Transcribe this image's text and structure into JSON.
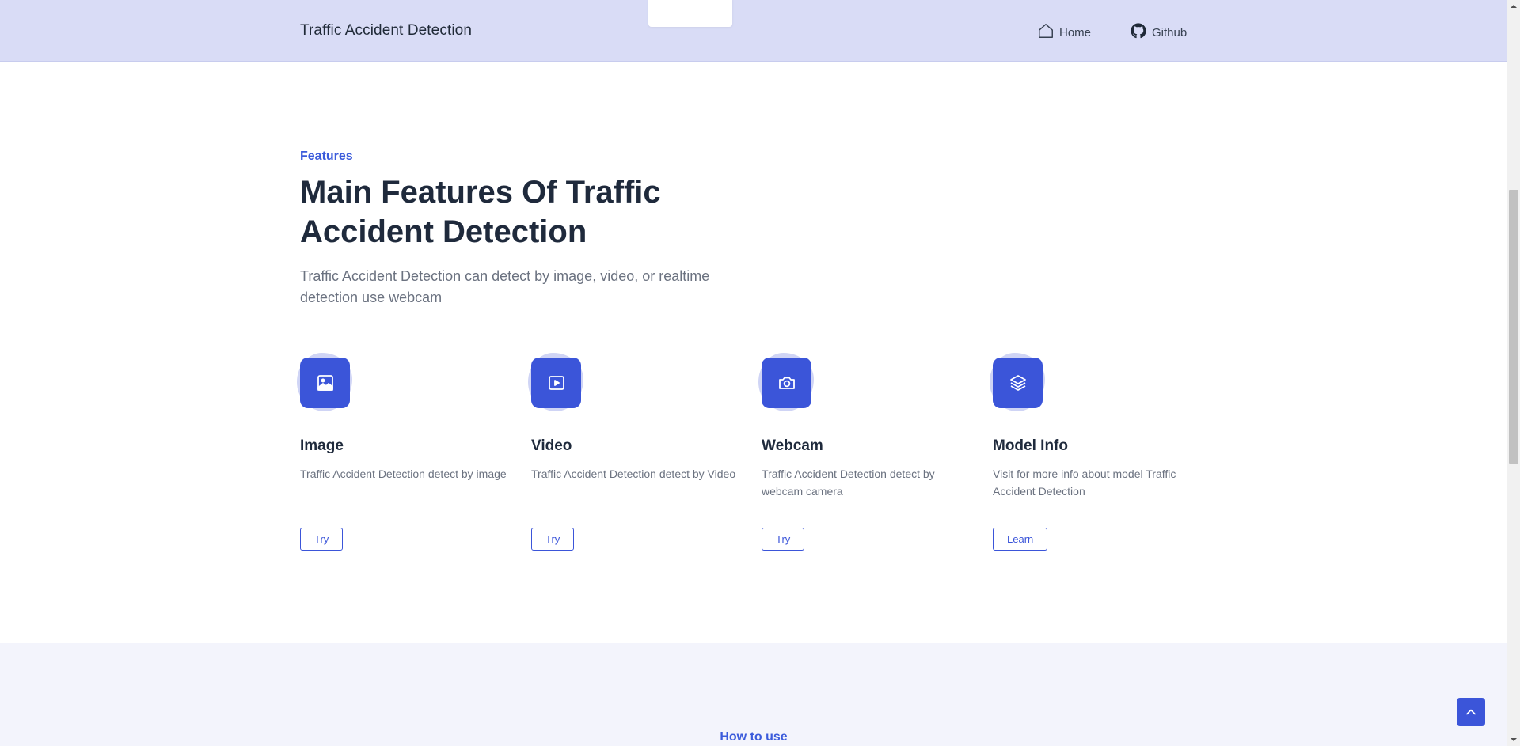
{
  "header": {
    "brand": "Traffic Accident Detection",
    "nav": [
      {
        "label": "Home",
        "icon": "home-icon"
      },
      {
        "label": "Github",
        "icon": "github-icon"
      }
    ]
  },
  "features": {
    "eyebrow": "Features",
    "title": "Main Features Of Traffic Accident Detection",
    "description": "Traffic Accident Detection can detect by image, video, or realtime detection use webcam",
    "cards": [
      {
        "title": "Image",
        "description": "Traffic Accident Detection detect by image",
        "button": "Try",
        "icon": "image-icon"
      },
      {
        "title": "Video",
        "description": "Traffic Accident Detection detect by Video",
        "button": "Try",
        "icon": "video-icon"
      },
      {
        "title": "Webcam",
        "description": "Traffic Accident Detection detect by webcam camera",
        "button": "Try",
        "icon": "camera-icon"
      },
      {
        "title": "Model Info",
        "description": "Visit for more info about model Traffic Accident Detection",
        "button": "Learn",
        "icon": "layers-icon"
      }
    ]
  },
  "how_to_use": {
    "eyebrow": "How to use"
  },
  "colors": {
    "accent": "#3b55d9",
    "navbar_bg": "#d9dcf6",
    "section_bg": "#f3f4fc"
  }
}
